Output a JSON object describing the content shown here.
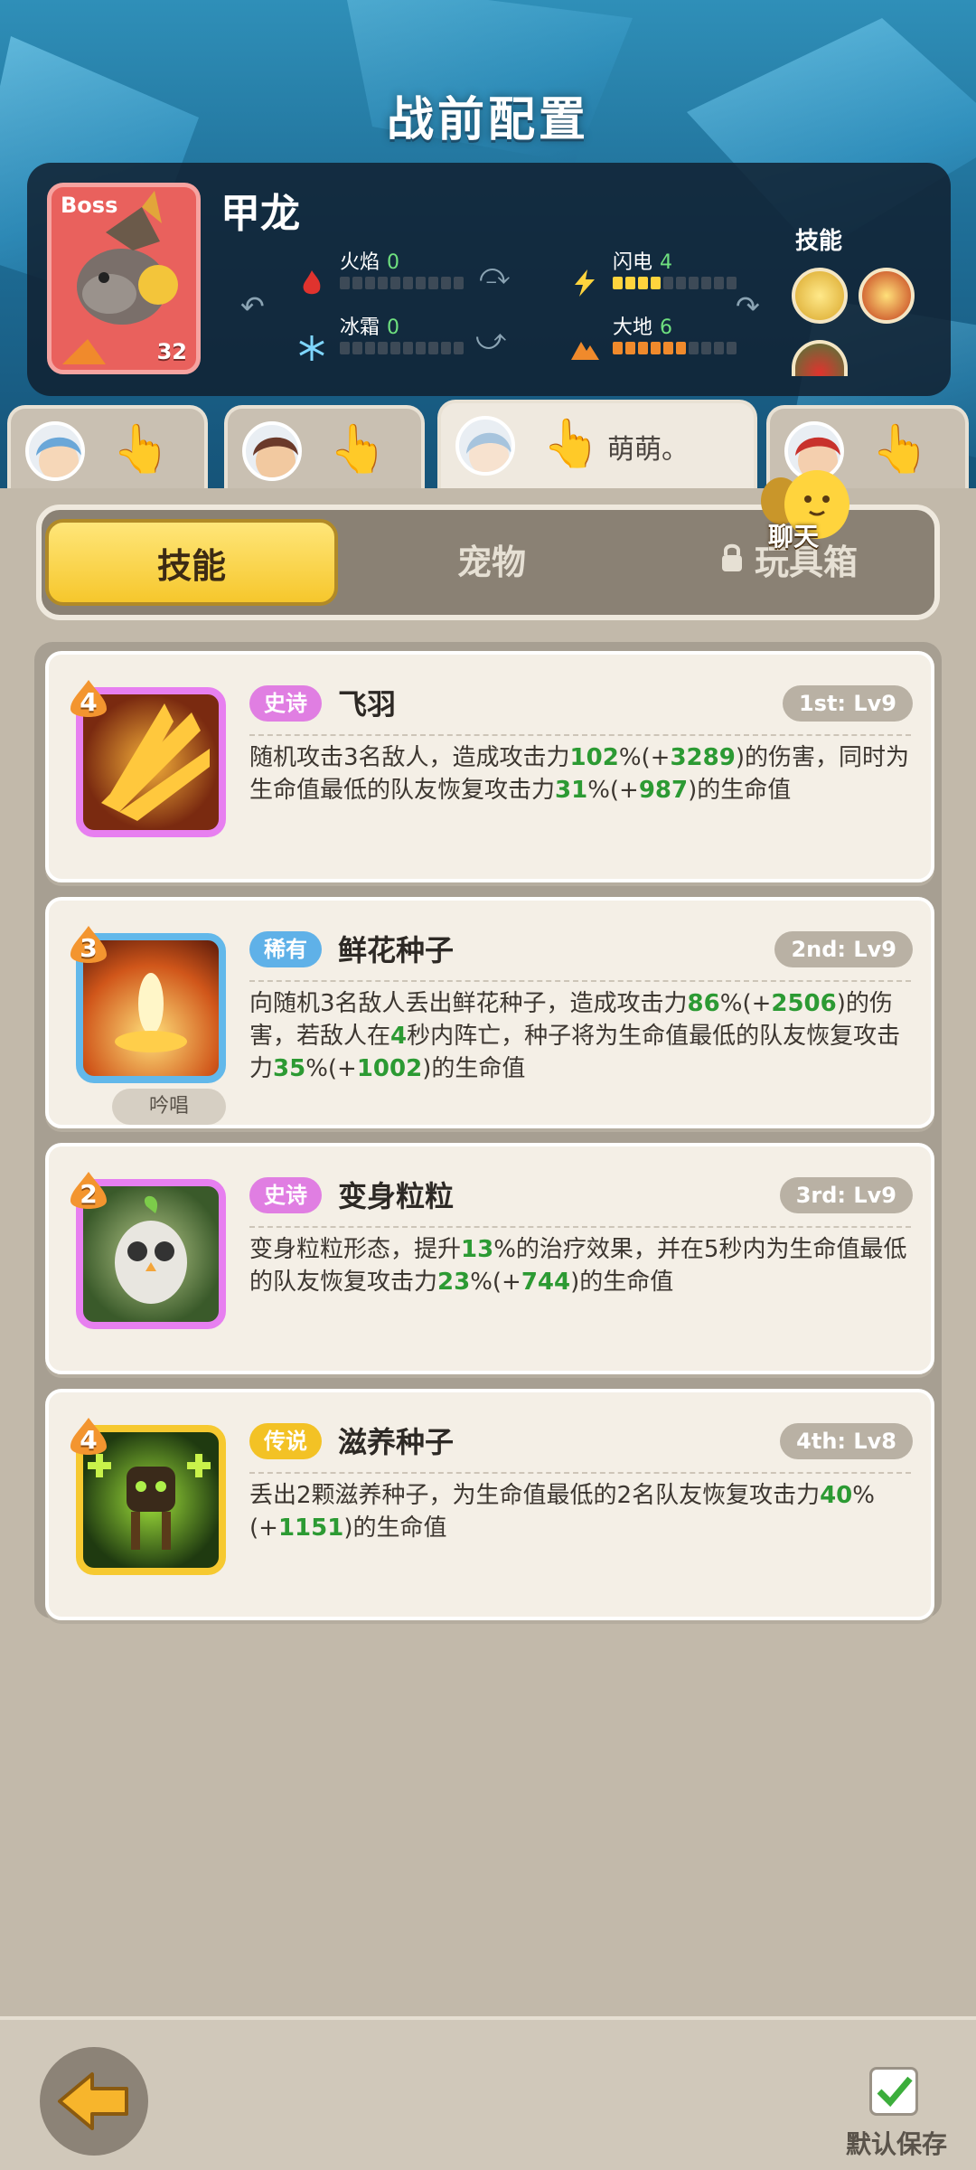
{
  "header": {
    "title": "战前配置"
  },
  "boss": {
    "tag": "Boss",
    "name": "甲龙",
    "level": "32",
    "stats": [
      {
        "label": "火焰",
        "value": "0",
        "icon": "fire-icon",
        "filled": 0
      },
      {
        "label": "闪电",
        "value": "4",
        "icon": "lightning-icon",
        "filled": 4
      },
      {
        "label": "冰霜",
        "value": "0",
        "icon": "snowflake-icon",
        "filled": 0
      },
      {
        "label": "大地",
        "value": "6",
        "icon": "earth-icon",
        "filled": 6
      }
    ],
    "skills_label": "技能"
  },
  "heroes": [
    {
      "name": "",
      "active": false
    },
    {
      "name": "",
      "active": false
    },
    {
      "name": "萌萌。",
      "active": true
    },
    {
      "name": "",
      "active": false
    }
  ],
  "tabs": {
    "skills": "技能",
    "pets": "宠物",
    "toybox": "玩具箱"
  },
  "chat": {
    "label": "聊天"
  },
  "skills": [
    {
      "level": "4",
      "rarity": "史诗",
      "name": "飞羽",
      "slot": "1st: Lv9",
      "desc_parts": [
        "随机攻击3名敌人，造成攻击力",
        "102",
        "%(+",
        "3289",
        ")的伤害，同时为生命值最低的队友恢复攻击力",
        "31",
        "%(+",
        "987",
        ")的生命值"
      ]
    },
    {
      "level": "3",
      "rarity": "稀有",
      "name": "鲜花种子",
      "slot": "2nd: Lv9",
      "tag": "吟唱",
      "desc_parts": [
        "向随机3名敌人丢出鲜花种子，造成攻击力",
        "86",
        "%(+",
        "2506",
        ")的伤害，若敌人在",
        "4",
        "秒内阵亡，种子将为生命值最低的队友恢复攻击力",
        "35",
        "%(+",
        "1002",
        ")的生命值"
      ]
    },
    {
      "level": "2",
      "rarity": "史诗",
      "name": "变身粒粒",
      "slot": "3rd: Lv9",
      "desc_parts": [
        "变身粒粒形态，提升",
        "13",
        "%的治疗效果，并在5秒内为生命值最低的队友恢复攻击力",
        "23",
        "%(+",
        "744",
        ")的生命值"
      ]
    },
    {
      "level": "4",
      "rarity": "传说",
      "name": "滋养种子",
      "slot": "4th: Lv8",
      "desc_parts": [
        "丢出2颗滋养种子，为生命值最低的2名队友恢复攻击力",
        "40",
        "%(+",
        "1151",
        ")的生命值"
      ]
    }
  ],
  "footer": {
    "save_label": "默认保存"
  },
  "colors": {
    "accent_yellow": "#f6c72c",
    "value_green": "#2c9a33",
    "epic": "#e07ee2",
    "rare": "#5fb1e8",
    "legend": "#f3c225"
  }
}
